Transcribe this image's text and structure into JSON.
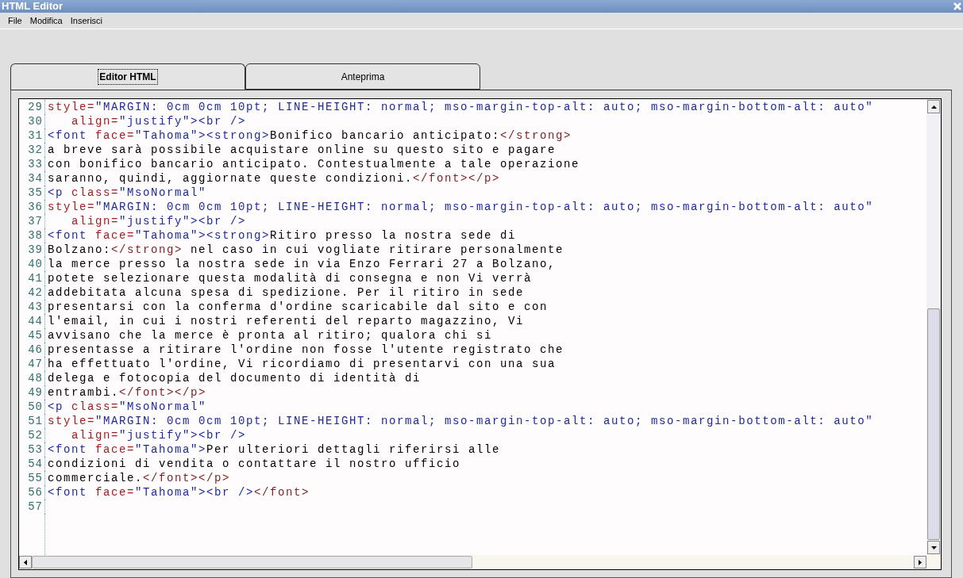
{
  "window": {
    "title": "HTML Editor"
  },
  "menu": [
    {
      "label": "File"
    },
    {
      "label": "Modifica"
    },
    {
      "label": "Inserisci"
    }
  ],
  "tabs": [
    {
      "label": "Editor HTML",
      "selected": true
    },
    {
      "label": "Anteprima",
      "selected": false
    }
  ],
  "editor": {
    "lines": [
      {
        "number": "29",
        "tokens": [
          {
            "kind": "attr",
            "text": "style="
          },
          {
            "kind": "value",
            "text": "\"MARGIN: 0cm 0cm 10pt; LINE-HEIGHT: normal; mso-margin-top-alt: auto; mso-margin-bottom-alt: auto\""
          }
        ]
      },
      {
        "number": "30",
        "tokens": [
          {
            "kind": "attr",
            "text": "   align="
          },
          {
            "kind": "value",
            "text": "\"justify\""
          },
          {
            "kind": "tag",
            "text": "><br />"
          }
        ]
      },
      {
        "number": "31",
        "tokens": [
          {
            "kind": "tag",
            "text": "<font "
          },
          {
            "kind": "attr",
            "text": "face="
          },
          {
            "kind": "value",
            "text": "\"Tahoma\""
          },
          {
            "kind": "tag",
            "text": "><strong>"
          },
          {
            "kind": "text",
            "text": "Bonifico bancario anticipato:"
          },
          {
            "kind": "close",
            "text": "</strong>"
          }
        ]
      },
      {
        "number": "32",
        "tokens": [
          {
            "kind": "text",
            "text": "a breve sarà possibile acquistare online su questo sito e pagare"
          }
        ]
      },
      {
        "number": "33",
        "tokens": [
          {
            "kind": "text",
            "text": "con bonifico bancario anticipato. Contestualmente a tale operazione"
          }
        ]
      },
      {
        "number": "34",
        "tokens": [
          {
            "kind": "text",
            "text": "saranno, quindi, aggiornate queste condizioni."
          },
          {
            "kind": "close",
            "text": "</font></p>"
          }
        ]
      },
      {
        "number": "35",
        "tokens": [
          {
            "kind": "tag",
            "text": "<p "
          },
          {
            "kind": "attr",
            "text": "class="
          },
          {
            "kind": "value",
            "text": "\"MsoNormal\""
          }
        ]
      },
      {
        "number": "36",
        "tokens": [
          {
            "kind": "attr",
            "text": "style="
          },
          {
            "kind": "value",
            "text": "\"MARGIN: 0cm 0cm 10pt; LINE-HEIGHT: normal; mso-margin-top-alt: auto; mso-margin-bottom-alt: auto\""
          }
        ]
      },
      {
        "number": "37",
        "tokens": [
          {
            "kind": "attr",
            "text": "   align="
          },
          {
            "kind": "value",
            "text": "\"justify\""
          },
          {
            "kind": "tag",
            "text": "><br />"
          }
        ]
      },
      {
        "number": "38",
        "tokens": [
          {
            "kind": "tag",
            "text": "<font "
          },
          {
            "kind": "attr",
            "text": "face="
          },
          {
            "kind": "value",
            "text": "\"Tahoma\""
          },
          {
            "kind": "tag",
            "text": "><strong>"
          },
          {
            "kind": "text",
            "text": "Ritiro presso la nostra sede di"
          }
        ]
      },
      {
        "number": "39",
        "tokens": [
          {
            "kind": "text",
            "text": "Bolzano:"
          },
          {
            "kind": "close",
            "text": "</strong>"
          },
          {
            "kind": "text",
            "text": " nel caso in cui vogliate ritirare personalmente"
          }
        ]
      },
      {
        "number": "40",
        "tokens": [
          {
            "kind": "text",
            "text": "la merce presso la nostra sede in via Enzo Ferrari 27 a Bolzano,"
          }
        ]
      },
      {
        "number": "41",
        "tokens": [
          {
            "kind": "text",
            "text": "potete selezionare questa modalità di consegna e non Vi verrà"
          }
        ]
      },
      {
        "number": "42",
        "tokens": [
          {
            "kind": "text",
            "text": "addebitata alcuna spesa di spedizione. Per il ritiro in sede"
          }
        ]
      },
      {
        "number": "43",
        "tokens": [
          {
            "kind": "text",
            "text": "presentarsi con la conferma d'ordine scaricabile dal sito e con"
          }
        ]
      },
      {
        "number": "44",
        "tokens": [
          {
            "kind": "text",
            "text": "l'email, in cui i nostri referenti del reparto magazzino, Vi"
          }
        ]
      },
      {
        "number": "45",
        "tokens": [
          {
            "kind": "text",
            "text": "avvisano che la merce è pronta al ritiro; qualora chi si"
          }
        ]
      },
      {
        "number": "46",
        "tokens": [
          {
            "kind": "text",
            "text": "presentasse a ritirare l'ordine non fosse l'utente registrato che"
          }
        ]
      },
      {
        "number": "47",
        "tokens": [
          {
            "kind": "text",
            "text": "ha effettuato l'ordine, Vi ricordiamo di presentarvi con una sua"
          }
        ]
      },
      {
        "number": "48",
        "tokens": [
          {
            "kind": "text",
            "text": "delega e fotocopia del documento di identità di"
          }
        ]
      },
      {
        "number": "49",
        "tokens": [
          {
            "kind": "text",
            "text": "entrambi."
          },
          {
            "kind": "close",
            "text": "</font></p>"
          }
        ]
      },
      {
        "number": "50",
        "tokens": [
          {
            "kind": "tag",
            "text": "<p "
          },
          {
            "kind": "attr",
            "text": "class="
          },
          {
            "kind": "value",
            "text": "\"MsoNormal\""
          }
        ]
      },
      {
        "number": "51",
        "tokens": [
          {
            "kind": "attr",
            "text": "style="
          },
          {
            "kind": "value",
            "text": "\"MARGIN: 0cm 0cm 10pt; LINE-HEIGHT: normal; mso-margin-top-alt: auto; mso-margin-bottom-alt: auto\""
          }
        ]
      },
      {
        "number": "52",
        "tokens": [
          {
            "kind": "attr",
            "text": "   align="
          },
          {
            "kind": "value",
            "text": "\"justify\""
          },
          {
            "kind": "tag",
            "text": "><br />"
          }
        ]
      },
      {
        "number": "53",
        "tokens": [
          {
            "kind": "tag",
            "text": "<font "
          },
          {
            "kind": "attr",
            "text": "face="
          },
          {
            "kind": "value",
            "text": "\"Tahoma\""
          },
          {
            "kind": "tag",
            "text": ">"
          },
          {
            "kind": "text",
            "text": "Per ulteriori dettagli riferirsi alle"
          }
        ]
      },
      {
        "number": "54",
        "tokens": [
          {
            "kind": "text",
            "text": "condizioni di vendita o contattare il nostro ufficio"
          }
        ]
      },
      {
        "number": "55",
        "tokens": [
          {
            "kind": "text",
            "text": "commerciale."
          },
          {
            "kind": "close",
            "text": "</font></p>"
          }
        ]
      },
      {
        "number": "56",
        "tokens": [
          {
            "kind": "tag",
            "text": "<font "
          },
          {
            "kind": "attr",
            "text": "face="
          },
          {
            "kind": "value",
            "text": "\"Tahoma\""
          },
          {
            "kind": "tag",
            "text": "><br />"
          },
          {
            "kind": "close",
            "text": "</font>"
          }
        ]
      },
      {
        "number": "57"
      }
    ]
  }
}
